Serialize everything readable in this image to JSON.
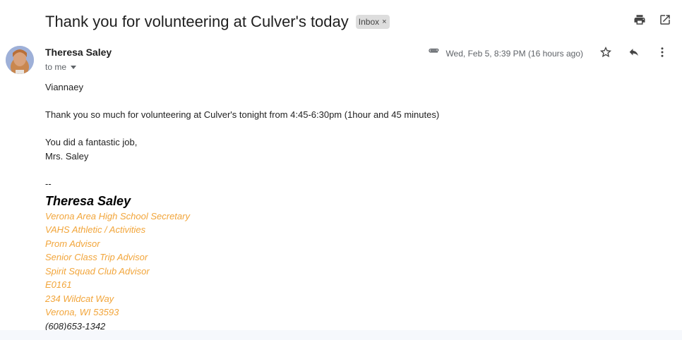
{
  "email": {
    "subject": "Thank you for volunteering at Culver's today",
    "label": "Inbox",
    "label_remove": "×",
    "sender": "Theresa Saley",
    "recipient": "to me",
    "date": "Wed, Feb 5, 8:39 PM (16 hours ago)"
  },
  "icons": {
    "print": "print-icon",
    "open_new_window": "open-in-new-window-icon",
    "attachment": "paperclip-icon",
    "star": "star-icon",
    "reply": "reply-icon",
    "more": "more-vert-icon"
  },
  "body": {
    "greeting": "Viannaey",
    "para1": "Thank you so much for volunteering at Culver's tonight from 4:45-6:30pm (1hour and 45 minutes)",
    "closing1": "You did a fantastic job,",
    "closing2": "Mrs. Saley",
    "separator": "--"
  },
  "signature": {
    "name": "Theresa Saley",
    "lines": [
      "Verona Area High School Secretary",
      "VAHS Athletic / Activities",
      "Prom Advisor",
      "Senior Class Trip Advisor",
      "Spirit Squad Club Advisor",
      "E0161",
      "234 Wildcat Way",
      "Verona, WI 53593"
    ],
    "phone": "(608)653-1342"
  },
  "colors": {
    "signature_accent": "#f2a53a",
    "label_chip_bg": "#dddddd"
  }
}
